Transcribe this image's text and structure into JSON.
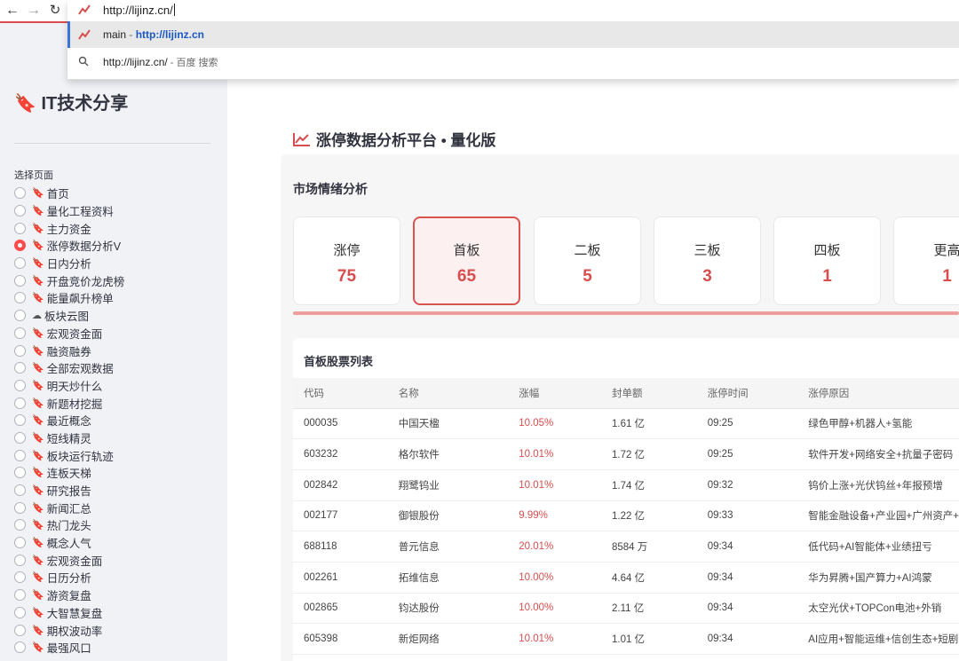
{
  "browser": {
    "url_input": "http://lijinz.cn/",
    "suggestions": [
      {
        "title": "main",
        "separator": " - ",
        "url": "http://lijinz.cn"
      },
      {
        "query": "http://lijinz.cn/",
        "tail": " - 百度 搜索"
      }
    ]
  },
  "sidebar": {
    "brand": "🔖 IT技术分享",
    "select_label": "选择页面",
    "items": [
      {
        "icon": "🔖",
        "label": "首页"
      },
      {
        "icon": "🔖",
        "label": "量化工程资料"
      },
      {
        "icon": "🔖",
        "label": "主力资金"
      },
      {
        "icon": "🔖",
        "label": "涨停数据分析V"
      },
      {
        "icon": "🔖",
        "label": "日内分析"
      },
      {
        "icon": "🔖",
        "label": "开盘竞价龙虎榜"
      },
      {
        "icon": "🔖",
        "label": "能量飙升榜单"
      },
      {
        "icon": "☁",
        "label": "板块云图"
      },
      {
        "icon": "🔖",
        "label": "宏观资金面"
      },
      {
        "icon": "🔖",
        "label": "融资融券"
      },
      {
        "icon": "🔖",
        "label": "全部宏观数据"
      },
      {
        "icon": "🔖",
        "label": "明天炒什么"
      },
      {
        "icon": "🔖",
        "label": "新题材挖掘"
      },
      {
        "icon": "🔖",
        "label": "最近概念"
      },
      {
        "icon": "🔖",
        "label": "短线精灵"
      },
      {
        "icon": "🔖",
        "label": "板块运行轨迹"
      },
      {
        "icon": "🔖",
        "label": "连板天梯"
      },
      {
        "icon": "🔖",
        "label": "研究报告"
      },
      {
        "icon": "🔖",
        "label": "新闻汇总"
      },
      {
        "icon": "🔖",
        "label": "热门龙头"
      },
      {
        "icon": "🔖",
        "label": "概念人气"
      },
      {
        "icon": "🔖",
        "label": "宏观资金面"
      },
      {
        "icon": "🔖",
        "label": "日历分析"
      },
      {
        "icon": "🔖",
        "label": "游资复盘"
      },
      {
        "icon": "🔖",
        "label": "大智慧复盘"
      },
      {
        "icon": "🔖",
        "label": "期权波动率"
      },
      {
        "icon": "🔖",
        "label": "最强风口"
      }
    ],
    "selected_index": 3
  },
  "main": {
    "title": "涨停数据分析平台 • 量化版",
    "section_title": "市场情绪分析",
    "cards": [
      {
        "label": "涨停",
        "value": "75"
      },
      {
        "label": "首板",
        "value": "65"
      },
      {
        "label": "二板",
        "value": "5"
      },
      {
        "label": "三板",
        "value": "3"
      },
      {
        "label": "四板",
        "value": "1"
      },
      {
        "label": "更高",
        "value": "1"
      }
    ],
    "active_card": 1,
    "list_title": "首板股票列表",
    "columns": [
      "代码",
      "名称",
      "涨幅",
      "封单额",
      "涨停时间",
      "涨停原因"
    ],
    "rows": [
      [
        "000035",
        "中国天楹",
        "10.05%",
        "1.61 亿",
        "09:25",
        "绿色甲醇+机器人+氢能"
      ],
      [
        "603232",
        "格尔软件",
        "10.01%",
        "1.72 亿",
        "09:25",
        "软件开发+网络安全+抗量子密码"
      ],
      [
        "002842",
        "翔鹭钨业",
        "10.01%",
        "1.74 亿",
        "09:32",
        "钨价上涨+光伏钨丝+年报预增"
      ],
      [
        "002177",
        "御银股份",
        "9.99%",
        "1.22 亿",
        "09:33",
        "智能金融设备+产业园+广州资产+"
      ],
      [
        "688118",
        "普元信息",
        "20.01%",
        "8584 万",
        "09:34",
        "低代码+AI智能体+业绩扭亏"
      ],
      [
        "002261",
        "拓维信息",
        "10.00%",
        "4.64 亿",
        "09:34",
        "华为昇腾+国产算力+AI鸿蒙"
      ],
      [
        "002865",
        "钧达股份",
        "10.00%",
        "2.11 亿",
        "09:34",
        "太空光伏+TOPCon电池+外销"
      ],
      [
        "605398",
        "新炬网络",
        "10.01%",
        "1.01 亿",
        "09:34",
        "AI应用+智能运维+信创生态+短剧"
      ]
    ]
  },
  "colors": {
    "accent": "#d84d4d",
    "radio_on": "#ff4b4b",
    "sidebar_bg": "#f0f2f6",
    "link": "#1a57c5"
  }
}
